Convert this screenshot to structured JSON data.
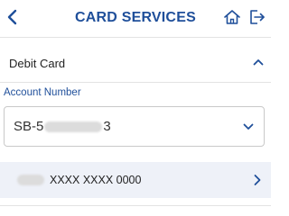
{
  "header": {
    "title": "CARD SERVICES",
    "back_icon": "chevron-left-icon",
    "home_icon": "home-icon",
    "logout_icon": "logout-icon"
  },
  "section": {
    "label": "Debit Card",
    "expanded": true
  },
  "account": {
    "label": "Account Number",
    "value_prefix": "SB-5",
    "value_suffix": "3"
  },
  "card": {
    "number": "XXXX XXXX 0000"
  },
  "colors": {
    "accent": "#1f4f9a",
    "row_highlight": "#eef1f8"
  }
}
